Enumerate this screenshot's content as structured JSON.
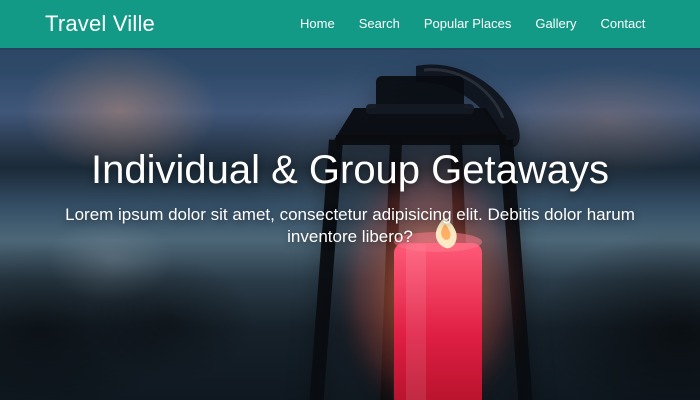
{
  "header": {
    "brand": "Travel Ville",
    "nav": [
      {
        "label": "Home"
      },
      {
        "label": "Search"
      },
      {
        "label": "Popular Places"
      },
      {
        "label": "Gallery"
      },
      {
        "label": "Contact"
      }
    ]
  },
  "hero": {
    "title": "Individual & Group Getaways",
    "subtitle": "Lorem ipsum dolor sit amet, consectetur adipisicing elit. Debitis dolor harum inventore libero?"
  },
  "theme": {
    "header_bg": "#139a86",
    "text": "#ffffff"
  }
}
